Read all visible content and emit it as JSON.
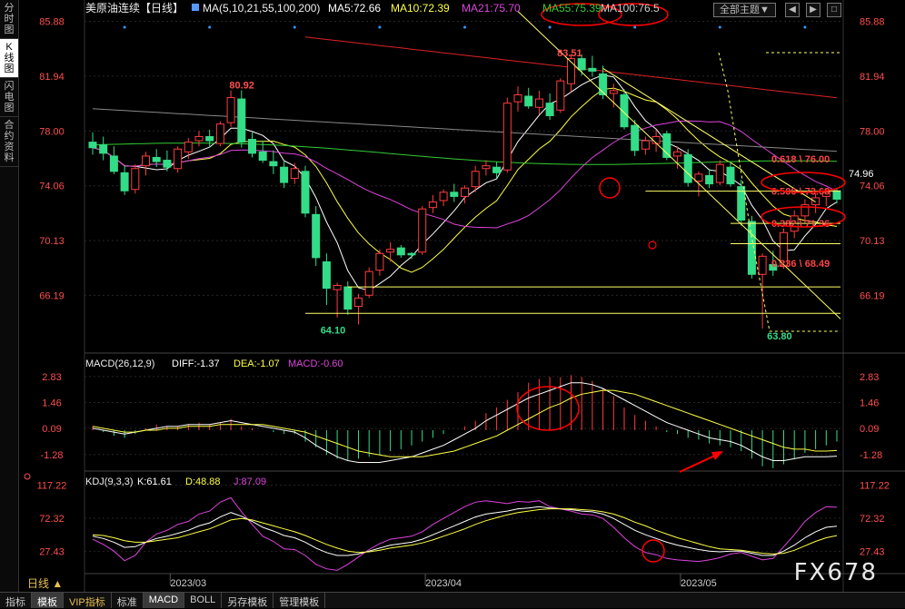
{
  "sidebar": [
    {
      "label": "分时图",
      "chars": [
        "分",
        "时",
        "图"
      ],
      "active": false
    },
    {
      "label": "K线图",
      "chars": [
        "K",
        "线",
        "图"
      ],
      "active": true
    },
    {
      "label": "闪电图",
      "chars": [
        "闪",
        "电",
        "图"
      ],
      "active": false
    },
    {
      "label": "合约资料",
      "chars": [
        "合",
        "约",
        "资",
        "料"
      ],
      "active": false
    }
  ],
  "header": {
    "title": "美原油连续【日线】",
    "ma_label": "MA(5,10,21,55,100,200)",
    "ma5": "MA5:72.66",
    "ma10": "MA10:72.39",
    "ma21": "MA21:75.70",
    "ma55": "MA55:75.39",
    "ma100": "MA100:76.5",
    "theme_button": "全部主题▼",
    "btn_left": "◀",
    "btn_right": "▶",
    "btn_expand": "□"
  },
  "colors": {
    "up": "#ff3c3c",
    "down": "#33dd88",
    "ma5": "#ffffff",
    "ma10": "#ffff44",
    "ma21": "#dd44dd",
    "ma55": "#33cc33",
    "ma100": "#888888",
    "ma200": "#dd2222",
    "annotation": "#ff0000",
    "fib": "#ff4444"
  },
  "price_axis": [
    "85.88",
    "81.94",
    "78.00",
    "74.06",
    "70.13",
    "66.19"
  ],
  "price_current": "74.96",
  "annotations": {
    "high1": "80.92",
    "high2": "83.51",
    "low1": "64.10",
    "low2": "63.80"
  },
  "fib": [
    "0.618 \\ 76.00",
    "0.500 \\ 73.68",
    "0.382 \\ 71.36",
    "0.236 \\ 68.49"
  ],
  "macd": {
    "label": "MACD(26,12,9)",
    "diff": "DIFF:-1.37",
    "dea": "DEA:-1.07",
    "macd": "MACD:-0.60",
    "axis": [
      "2.83",
      "1.46",
      "0.09",
      "-1.28"
    ]
  },
  "kdj": {
    "label": "KDJ(9,3,3)",
    "k": "K:61.61",
    "d": "D:48.88",
    "j": "J:87.09",
    "axis": [
      "117.22",
      "72.32",
      "27.43"
    ]
  },
  "dates": [
    "2023/03",
    "2023/04",
    "2023/05"
  ],
  "period_label": "日线 ▲",
  "watermark": "FX678",
  "tabs": [
    {
      "label": "指标",
      "active": false
    },
    {
      "label": "模板",
      "active": true
    },
    {
      "label": "VIP指标",
      "active": false,
      "vip": true
    },
    {
      "label": "标准",
      "active": false
    },
    {
      "label": "MACD",
      "active": true
    },
    {
      "label": "BOLL",
      "active": false
    },
    {
      "label": "另存模板",
      "active": false
    },
    {
      "label": "管理模板",
      "active": false
    }
  ],
  "chart_data": {
    "type": "candlestick",
    "title": "美原油连续【日线】",
    "ylim": [
      62.5,
      86.5
    ],
    "x_labels": [
      "2023/03",
      "2023/04",
      "2023/05"
    ],
    "candles": [
      [
        77.2,
        77.9,
        76.3,
        76.8
      ],
      [
        77.0,
        77.6,
        75.9,
        76.4
      ],
      [
        76.2,
        76.9,
        74.9,
        75.1
      ],
      [
        75.0,
        75.5,
        73.4,
        73.7
      ],
      [
        73.8,
        75.6,
        73.5,
        75.3
      ],
      [
        75.5,
        76.5,
        74.8,
        76.2
      ],
      [
        76.1,
        76.7,
        75.4,
        75.8
      ],
      [
        75.9,
        76.6,
        75.1,
        75.4
      ],
      [
        75.3,
        76.9,
        75.0,
        76.7
      ],
      [
        76.5,
        77.5,
        76.0,
        77.2
      ],
      [
        77.3,
        78.0,
        76.9,
        77.6
      ],
      [
        77.6,
        78.1,
        76.8,
        77.3
      ],
      [
        77.1,
        78.7,
        76.9,
        78.5
      ],
      [
        78.6,
        80.92,
        78.3,
        80.4
      ],
      [
        80.3,
        80.92,
        76.8,
        77.2
      ],
      [
        77.4,
        77.9,
        76.1,
        76.4
      ],
      [
        76.5,
        77.3,
        75.7,
        75.9
      ],
      [
        75.8,
        76.6,
        74.9,
        75.5
      ],
      [
        75.4,
        75.8,
        73.9,
        74.3
      ],
      [
        74.6,
        75.7,
        74.2,
        75.3
      ],
      [
        75.1,
        75.5,
        71.8,
        72.1
      ],
      [
        72.0,
        72.6,
        68.3,
        68.9
      ],
      [
        68.6,
        69.2,
        65.5,
        66.7
      ],
      [
        66.6,
        67.1,
        64.6,
        66.9
      ],
      [
        66.8,
        67.2,
        64.8,
        65.2
      ],
      [
        65.4,
        66.3,
        64.1,
        66.0
      ],
      [
        66.2,
        68.2,
        66.0,
        67.9
      ],
      [
        68.0,
        69.5,
        67.6,
        69.2
      ],
      [
        69.3,
        70.0,
        68.6,
        69.5
      ],
      [
        69.6,
        69.8,
        68.9,
        69.1
      ],
      [
        69.2,
        69.3,
        68.8,
        69.1
      ],
      [
        69.3,
        72.6,
        69.1,
        72.4
      ],
      [
        72.5,
        73.4,
        72.1,
        72.9
      ],
      [
        73.0,
        73.8,
        72.6,
        73.6
      ],
      [
        73.6,
        74.2,
        72.9,
        73.3
      ],
      [
        73.3,
        74.1,
        72.8,
        73.9
      ],
      [
        74.0,
        75.5,
        73.6,
        75.1
      ],
      [
        75.3,
        75.9,
        74.8,
        75.5
      ],
      [
        75.4,
        75.8,
        74.6,
        75.0
      ],
      [
        75.2,
        80.4,
        75.0,
        80.0
      ],
      [
        80.1,
        81.2,
        79.4,
        80.6
      ],
      [
        80.5,
        81.1,
        79.6,
        79.8
      ],
      [
        79.7,
        80.9,
        79.2,
        80.3
      ],
      [
        80.0,
        80.7,
        78.8,
        79.1
      ],
      [
        79.5,
        81.8,
        79.3,
        81.6
      ],
      [
        81.4,
        83.51,
        80.8,
        83.2
      ],
      [
        83.2,
        83.51,
        82.0,
        82.4
      ],
      [
        82.5,
        83.4,
        81.9,
        82.3
      ],
      [
        82.1,
        82.7,
        80.3,
        80.6
      ],
      [
        80.7,
        81.4,
        79.7,
        80.9
      ],
      [
        80.6,
        81.0,
        78.1,
        78.3
      ],
      [
        78.4,
        78.8,
        76.2,
        76.6
      ],
      [
        76.7,
        77.6,
        76.3,
        77.3
      ],
      [
        77.1,
        78.1,
        76.5,
        77.6
      ],
      [
        77.8,
        78.0,
        75.9,
        76.1
      ],
      [
        76.2,
        76.9,
        75.3,
        76.5
      ],
      [
        76.3,
        76.7,
        74.0,
        74.3
      ],
      [
        74.4,
        75.1,
        73.3,
        74.9
      ],
      [
        74.8,
        75.3,
        73.9,
        74.2
      ],
      [
        74.3,
        75.9,
        74.1,
        75.6
      ],
      [
        75.4,
        75.8,
        74.0,
        74.2
      ],
      [
        74.0,
        74.5,
        71.2,
        71.6
      ],
      [
        71.5,
        71.9,
        67.4,
        67.7
      ],
      [
        67.7,
        69.2,
        63.8,
        69.0
      ],
      [
        68.4,
        69.4,
        67.6,
        68.0
      ],
      [
        68.3,
        71.0,
        68.1,
        70.7
      ],
      [
        70.8,
        72.3,
        70.3,
        71.9
      ],
      [
        71.9,
        73.1,
        71.4,
        72.7
      ],
      [
        72.7,
        73.5,
        72.1,
        73.2
      ],
      [
        73.3,
        73.8,
        72.6,
        73.6
      ],
      [
        73.7,
        73.9,
        72.8,
        73.1
      ]
    ],
    "ma_lines": [
      "MA5",
      "MA10",
      "MA21",
      "MA55",
      "MA100",
      "MA200"
    ],
    "fib_levels": [
      {
        "ratio": "0.618",
        "price": 76.0
      },
      {
        "ratio": "0.500",
        "price": 73.68
      },
      {
        "ratio": "0.382",
        "price": 71.36
      },
      {
        "ratio": "0.236",
        "price": 68.49
      }
    ],
    "macd_ylim": [
      -2.2,
      3.3
    ],
    "macd_hist": [
      0.2,
      -0.1,
      -0.3,
      -0.4,
      -0.2,
      0.1,
      0.3,
      0.2,
      0.2,
      0.3,
      0.4,
      0.3,
      0.4,
      0.6,
      0.2,
      0.1,
      0.0,
      -0.1,
      -0.2,
      -0.2,
      -0.6,
      -0.9,
      -1.3,
      -1.5,
      -1.6,
      -1.5,
      -1.4,
      -1.3,
      -1.1,
      -1.0,
      -0.8,
      -0.6,
      -0.4,
      -0.2,
      0.0,
      0.2,
      0.5,
      0.9,
      1.2,
      1.6,
      2.0,
      2.5,
      2.7,
      2.8,
      2.8,
      2.9,
      2.8,
      2.6,
      2.2,
      1.8,
      1.2,
      0.8,
      0.5,
      0.2,
      -0.1,
      -0.2,
      -0.4,
      -0.5,
      -0.7,
      -0.8,
      -0.9,
      -1.1,
      -1.5,
      -1.9,
      -2.0,
      -1.8,
      -1.5,
      -1.2,
      -1.0,
      -0.8,
      -0.6
    ],
    "macd_diff": [
      0.1,
      0.0,
      -0.1,
      -0.2,
      -0.1,
      0.0,
      0.1,
      0.2,
      0.2,
      0.3,
      0.3,
      0.3,
      0.4,
      0.5,
      0.4,
      0.3,
      0.2,
      0.1,
      0.0,
      -0.1,
      -0.4,
      -0.8,
      -1.1,
      -1.4,
      -1.6,
      -1.7,
      -1.7,
      -1.7,
      -1.6,
      -1.5,
      -1.4,
      -1.2,
      -1.0,
      -0.8,
      -0.5,
      -0.2,
      0.1,
      0.5,
      0.8,
      1.1,
      1.4,
      1.7,
      1.9,
      2.1,
      2.3,
      2.5,
      2.5,
      2.4,
      2.2,
      1.9,
      1.6,
      1.3,
      1.0,
      0.7,
      0.4,
      0.2,
      0.0,
      -0.2,
      -0.4,
      -0.5,
      -0.6,
      -0.8,
      -1.1,
      -1.4,
      -1.6,
      -1.6,
      -1.5,
      -1.4,
      -1.4,
      -1.4,
      -1.37
    ],
    "macd_dea": [
      0.2,
      0.1,
      0.0,
      -0.1,
      -0.1,
      0.0,
      0.0,
      0.1,
      0.1,
      0.2,
      0.2,
      0.2,
      0.3,
      0.3,
      0.3,
      0.3,
      0.3,
      0.2,
      0.1,
      0.0,
      -0.1,
      -0.3,
      -0.5,
      -0.7,
      -0.9,
      -1.1,
      -1.2,
      -1.3,
      -1.4,
      -1.4,
      -1.4,
      -1.4,
      -1.3,
      -1.2,
      -1.1,
      -0.9,
      -0.7,
      -0.5,
      -0.3,
      0.0,
      0.3,
      0.6,
      0.9,
      1.2,
      1.4,
      1.7,
      1.9,
      2.0,
      2.1,
      2.1,
      2.0,
      1.9,
      1.7,
      1.5,
      1.3,
      1.1,
      0.9,
      0.7,
      0.5,
      0.3,
      0.1,
      -0.1,
      -0.3,
      -0.5,
      -0.7,
      -0.9,
      -1.0,
      -1.0,
      -1.1,
      -1.1,
      -1.07
    ],
    "kdj_ylim": [
      0,
      125
    ],
    "kdj_k": [
      48,
      45,
      40,
      33,
      34,
      40,
      45,
      48,
      52,
      56,
      62,
      66,
      74,
      80,
      75,
      68,
      60,
      55,
      49,
      46,
      40,
      32,
      26,
      22,
      22,
      24,
      28,
      32,
      36,
      38,
      40,
      44,
      50,
      56,
      62,
      68,
      74,
      78,
      80,
      82,
      85,
      86,
      88,
      86,
      85,
      84,
      82,
      81,
      78,
      72,
      64,
      56,
      50,
      45,
      40,
      36,
      33,
      30,
      28,
      27,
      28,
      28,
      25,
      22,
      22,
      28,
      36,
      46,
      54,
      60,
      61.61
    ],
    "kdj_d": [
      50,
      49,
      46,
      42,
      40,
      40,
      42,
      44,
      46,
      50,
      54,
      58,
      64,
      70,
      72,
      70,
      66,
      62,
      58,
      54,
      49,
      43,
      37,
      32,
      28,
      26,
      27,
      29,
      32,
      34,
      36,
      39,
      43,
      48,
      53,
      58,
      64,
      69,
      73,
      77,
      80,
      82,
      84,
      85,
      85,
      85,
      84,
      83,
      81,
      78,
      73,
      67,
      62,
      56,
      51,
      46,
      42,
      38,
      34,
      31,
      30,
      29,
      27,
      25,
      24,
      25,
      29,
      35,
      41,
      46,
      48.88
    ],
    "kdj_j": [
      44,
      37,
      28,
      15,
      22,
      40,
      51,
      56,
      64,
      68,
      78,
      82,
      94,
      100,
      81,
      64,
      48,
      41,
      31,
      30,
      22,
      10,
      4,
      2,
      10,
      20,
      30,
      38,
      44,
      46,
      48,
      54,
      64,
      72,
      80,
      88,
      94,
      96,
      94,
      92,
      95,
      94,
      96,
      88,
      85,
      82,
      78,
      77,
      72,
      60,
      46,
      34,
      26,
      23,
      18,
      16,
      15,
      14,
      16,
      19,
      24,
      26,
      21,
      16,
      18,
      34,
      50,
      68,
      80,
      88,
      87.09
    ]
  }
}
